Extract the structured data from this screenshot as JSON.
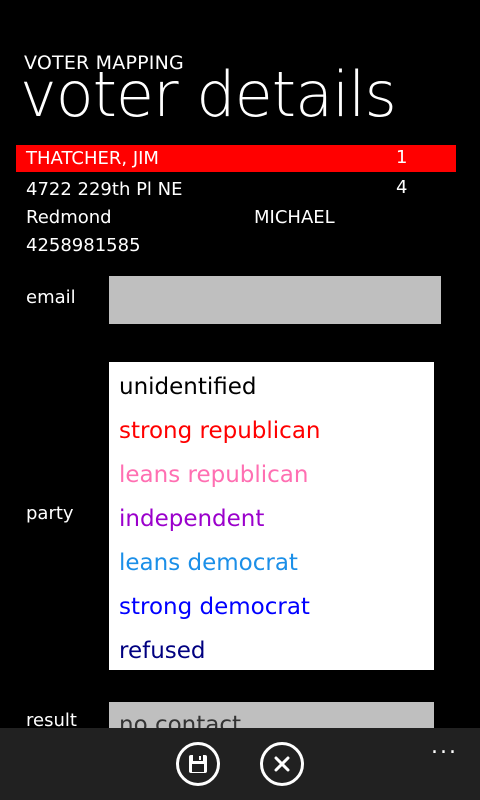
{
  "header": {
    "app_title": "VOTER MAPPING",
    "page_title": "voter details"
  },
  "voter": {
    "name": "THATCHER, JIM",
    "number": "1",
    "address": "4722 229th Pl NE",
    "address_number": "4",
    "city": "Redmond",
    "precinct": "MICHAEL",
    "phone": "4258981585"
  },
  "form": {
    "email_label": "email",
    "email_value": "",
    "party_label": "party",
    "party_options": [
      {
        "label": "unidentified",
        "color": "#000000"
      },
      {
        "label": "strong republican",
        "color": "#ff0000"
      },
      {
        "label": "leans republican",
        "color": "#ff6fb2"
      },
      {
        "label": "independent",
        "color": "#9b00cc"
      },
      {
        "label": "leans democrat",
        "color": "#1b8fe8"
      },
      {
        "label": "strong democrat",
        "color": "#0000ff"
      },
      {
        "label": "refused",
        "color": "#000080"
      }
    ],
    "result_label": "result",
    "result_value": "no contact"
  },
  "appbar": {
    "save_icon": "save-icon",
    "cancel_icon": "close-icon",
    "more": "..."
  },
  "colors": {
    "highlight": "#ff0000",
    "field": "#bfbfbf",
    "appbar": "#212121"
  }
}
